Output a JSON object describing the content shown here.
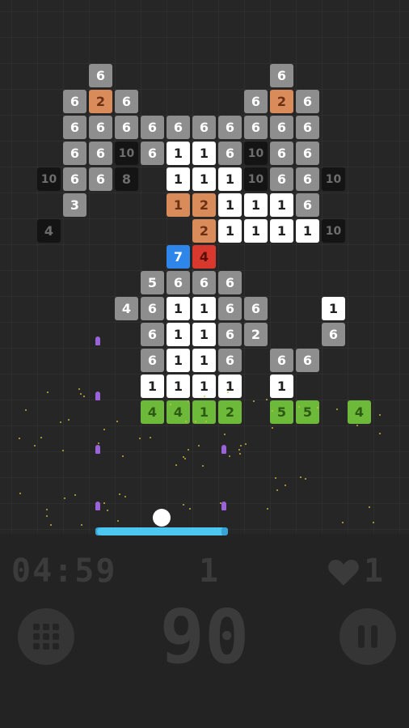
{
  "colors": {
    "background": "#232323",
    "gray": "#8e8e8e",
    "white": "#ffffff",
    "black": "#141414",
    "orange": "#d98b5a",
    "blue": "#2f86ea",
    "red": "#d8382d",
    "green": "#6dba3a",
    "paddle": "#4cc8f0",
    "bullet": "#9b63d8",
    "hud": "#3b3b3b"
  },
  "bricks": [
    {
      "row": 0,
      "col": 3,
      "value": "6",
      "tone": "gray"
    },
    {
      "row": 0,
      "col": 10,
      "value": "6",
      "tone": "gray"
    },
    {
      "row": 1,
      "col": 2,
      "value": "6",
      "tone": "gray"
    },
    {
      "row": 1,
      "col": 3,
      "value": "2",
      "tone": "orange"
    },
    {
      "row": 1,
      "col": 4,
      "value": "6",
      "tone": "gray"
    },
    {
      "row": 1,
      "col": 9,
      "value": "6",
      "tone": "gray"
    },
    {
      "row": 1,
      "col": 10,
      "value": "2",
      "tone": "orange"
    },
    {
      "row": 1,
      "col": 11,
      "value": "6",
      "tone": "gray"
    },
    {
      "row": 2,
      "col": 2,
      "value": "6",
      "tone": "gray"
    },
    {
      "row": 2,
      "col": 3,
      "value": "6",
      "tone": "gray"
    },
    {
      "row": 2,
      "col": 4,
      "value": "6",
      "tone": "gray"
    },
    {
      "row": 2,
      "col": 5,
      "value": "6",
      "tone": "gray"
    },
    {
      "row": 2,
      "col": 6,
      "value": "6",
      "tone": "gray"
    },
    {
      "row": 2,
      "col": 7,
      "value": "6",
      "tone": "gray"
    },
    {
      "row": 2,
      "col": 8,
      "value": "6",
      "tone": "gray"
    },
    {
      "row": 2,
      "col": 9,
      "value": "6",
      "tone": "gray"
    },
    {
      "row": 2,
      "col": 10,
      "value": "6",
      "tone": "gray"
    },
    {
      "row": 2,
      "col": 11,
      "value": "6",
      "tone": "gray"
    },
    {
      "row": 3,
      "col": 2,
      "value": "6",
      "tone": "gray"
    },
    {
      "row": 3,
      "col": 3,
      "value": "6",
      "tone": "gray"
    },
    {
      "row": 3,
      "col": 4,
      "value": "10",
      "tone": "black"
    },
    {
      "row": 3,
      "col": 5,
      "value": "6",
      "tone": "gray"
    },
    {
      "row": 3,
      "col": 6,
      "value": "1",
      "tone": "white"
    },
    {
      "row": 3,
      "col": 7,
      "value": "1",
      "tone": "white"
    },
    {
      "row": 3,
      "col": 8,
      "value": "6",
      "tone": "gray"
    },
    {
      "row": 3,
      "col": 9,
      "value": "10",
      "tone": "black"
    },
    {
      "row": 3,
      "col": 10,
      "value": "6",
      "tone": "gray"
    },
    {
      "row": 3,
      "col": 11,
      "value": "6",
      "tone": "gray"
    },
    {
      "row": 4,
      "col": 1,
      "value": "10",
      "tone": "black"
    },
    {
      "row": 4,
      "col": 2,
      "value": "6",
      "tone": "gray"
    },
    {
      "row": 4,
      "col": 3,
      "value": "6",
      "tone": "gray"
    },
    {
      "row": 4,
      "col": 4,
      "value": "8",
      "tone": "black"
    },
    {
      "row": 4,
      "col": 6,
      "value": "1",
      "tone": "white"
    },
    {
      "row": 4,
      "col": 7,
      "value": "1",
      "tone": "white"
    },
    {
      "row": 4,
      "col": 8,
      "value": "1",
      "tone": "white"
    },
    {
      "row": 4,
      "col": 9,
      "value": "10",
      "tone": "black"
    },
    {
      "row": 4,
      "col": 10,
      "value": "6",
      "tone": "gray"
    },
    {
      "row": 4,
      "col": 11,
      "value": "6",
      "tone": "gray"
    },
    {
      "row": 4,
      "col": 12,
      "value": "10",
      "tone": "black"
    },
    {
      "row": 5,
      "col": 2,
      "value": "3",
      "tone": "gray"
    },
    {
      "row": 5,
      "col": 6,
      "value": "1",
      "tone": "orange"
    },
    {
      "row": 5,
      "col": 7,
      "value": "2",
      "tone": "orange"
    },
    {
      "row": 5,
      "col": 8,
      "value": "1",
      "tone": "white"
    },
    {
      "row": 5,
      "col": 9,
      "value": "1",
      "tone": "white"
    },
    {
      "row": 5,
      "col": 10,
      "value": "1",
      "tone": "white"
    },
    {
      "row": 5,
      "col": 11,
      "value": "6",
      "tone": "gray"
    },
    {
      "row": 6,
      "col": 1,
      "value": "4",
      "tone": "black"
    },
    {
      "row": 6,
      "col": 7,
      "value": "2",
      "tone": "orange"
    },
    {
      "row": 6,
      "col": 8,
      "value": "1",
      "tone": "white"
    },
    {
      "row": 6,
      "col": 9,
      "value": "1",
      "tone": "white"
    },
    {
      "row": 6,
      "col": 10,
      "value": "1",
      "tone": "white"
    },
    {
      "row": 6,
      "col": 11,
      "value": "1",
      "tone": "white"
    },
    {
      "row": 6,
      "col": 12,
      "value": "10",
      "tone": "black"
    },
    {
      "row": 7,
      "col": 6,
      "value": "7",
      "tone": "blue"
    },
    {
      "row": 7,
      "col": 7,
      "value": "4",
      "tone": "red"
    },
    {
      "row": 8,
      "col": 5,
      "value": "5",
      "tone": "gray"
    },
    {
      "row": 8,
      "col": 6,
      "value": "6",
      "tone": "gray"
    },
    {
      "row": 8,
      "col": 7,
      "value": "6",
      "tone": "gray"
    },
    {
      "row": 8,
      "col": 8,
      "value": "6",
      "tone": "gray"
    },
    {
      "row": 9,
      "col": 4,
      "value": "4",
      "tone": "gray"
    },
    {
      "row": 9,
      "col": 5,
      "value": "6",
      "tone": "gray"
    },
    {
      "row": 9,
      "col": 6,
      "value": "1",
      "tone": "white"
    },
    {
      "row": 9,
      "col": 7,
      "value": "1",
      "tone": "white"
    },
    {
      "row": 9,
      "col": 8,
      "value": "6",
      "tone": "gray"
    },
    {
      "row": 9,
      "col": 9,
      "value": "6",
      "tone": "gray"
    },
    {
      "row": 9,
      "col": 12,
      "value": "1",
      "tone": "white"
    },
    {
      "row": 10,
      "col": 5,
      "value": "6",
      "tone": "gray"
    },
    {
      "row": 10,
      "col": 6,
      "value": "1",
      "tone": "white"
    },
    {
      "row": 10,
      "col": 7,
      "value": "1",
      "tone": "white"
    },
    {
      "row": 10,
      "col": 8,
      "value": "6",
      "tone": "gray"
    },
    {
      "row": 10,
      "col": 9,
      "value": "2",
      "tone": "gray"
    },
    {
      "row": 10,
      "col": 12,
      "value": "6",
      "tone": "gray"
    },
    {
      "row": 11,
      "col": 5,
      "value": "6",
      "tone": "gray"
    },
    {
      "row": 11,
      "col": 6,
      "value": "1",
      "tone": "white"
    },
    {
      "row": 11,
      "col": 7,
      "value": "1",
      "tone": "white"
    },
    {
      "row": 11,
      "col": 8,
      "value": "6",
      "tone": "gray"
    },
    {
      "row": 11,
      "col": 10,
      "value": "6",
      "tone": "gray"
    },
    {
      "row": 11,
      "col": 11,
      "value": "6",
      "tone": "gray"
    },
    {
      "row": 12,
      "col": 5,
      "value": "1",
      "tone": "white"
    },
    {
      "row": 12,
      "col": 6,
      "value": "1",
      "tone": "white"
    },
    {
      "row": 12,
      "col": 7,
      "value": "1",
      "tone": "white"
    },
    {
      "row": 12,
      "col": 8,
      "value": "1",
      "tone": "white"
    },
    {
      "row": 12,
      "col": 10,
      "value": "1",
      "tone": "white"
    },
    {
      "row": 13,
      "col": 5,
      "value": "4",
      "tone": "green"
    },
    {
      "row": 13,
      "col": 6,
      "value": "4",
      "tone": "green"
    },
    {
      "row": 13,
      "col": 7,
      "value": "1",
      "tone": "green"
    },
    {
      "row": 13,
      "col": 8,
      "value": "2",
      "tone": "green"
    },
    {
      "row": 13,
      "col": 10,
      "value": "5",
      "tone": "green"
    },
    {
      "row": 13,
      "col": 11,
      "value": "5",
      "tone": "green"
    },
    {
      "row": 13,
      "col": 13,
      "value": "4",
      "tone": "green"
    }
  ],
  "hud": {
    "timer": "04:59",
    "level": "1",
    "lives": "1",
    "score": "90",
    "heart_icon": "heart-icon",
    "menu_icon": "grid-icon",
    "pause_icon": "pause-icon"
  }
}
